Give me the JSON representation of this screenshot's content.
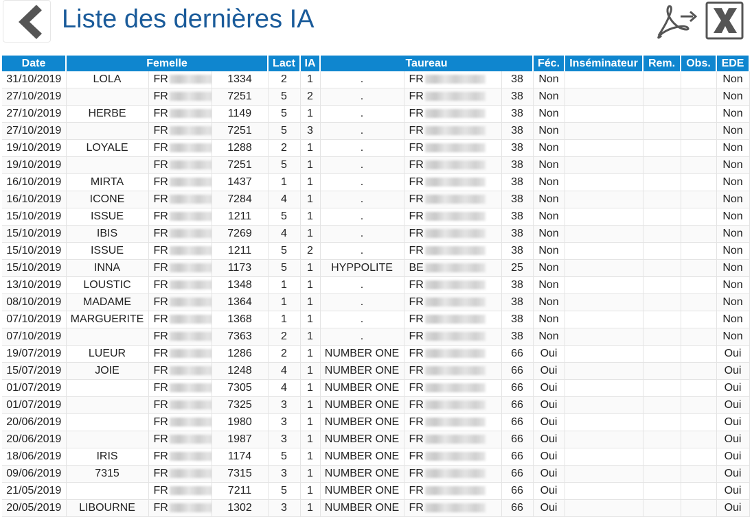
{
  "header": {
    "title": "Liste des dernières IA"
  },
  "icons": {
    "back": "chevron-left-icon",
    "pdf": "pdf-export-icon",
    "excel": "excel-export-icon"
  },
  "colors": {
    "header_bg": "#0f86cf",
    "title": "#1a5b9a"
  },
  "table": {
    "headers": {
      "date": "Date",
      "femelle": "Femelle",
      "lact": "Lact",
      "ia": "IA",
      "taureau": "Taureau",
      "fec": "Féc.",
      "inseminateur": "Inséminateur",
      "rem": "Rem.",
      "obs": "Obs.",
      "ede": "EDE"
    },
    "rows": [
      {
        "date": "31/10/2019",
        "name": "LOLA",
        "fr": "FR",
        "num": "1334",
        "lact": "2",
        "ia": "1",
        "bull": ".",
        "bull_fr": "FR",
        "bull_code": "38",
        "fec": "Non",
        "ins": "",
        "rem": "",
        "obs": "",
        "ede": "Non"
      },
      {
        "date": "27/10/2019",
        "name": "",
        "fr": "FR",
        "num": "7251",
        "lact": "5",
        "ia": "2",
        "bull": ".",
        "bull_fr": "FR",
        "bull_code": "38",
        "fec": "Non",
        "ins": "",
        "rem": "",
        "obs": "",
        "ede": "Non"
      },
      {
        "date": "27/10/2019",
        "name": "HERBE",
        "fr": "FR",
        "num": "1149",
        "lact": "5",
        "ia": "1",
        "bull": ".",
        "bull_fr": "FR",
        "bull_code": "38",
        "fec": "Non",
        "ins": "",
        "rem": "",
        "obs": "",
        "ede": "Non"
      },
      {
        "date": "27/10/2019",
        "name": "",
        "fr": "FR",
        "num": "7251",
        "lact": "5",
        "ia": "3",
        "bull": ".",
        "bull_fr": "FR",
        "bull_code": "38",
        "fec": "Non",
        "ins": "",
        "rem": "",
        "obs": "",
        "ede": "Non"
      },
      {
        "date": "19/10/2019",
        "name": "LOYALE",
        "fr": "FR",
        "num": "1288",
        "lact": "2",
        "ia": "1",
        "bull": ".",
        "bull_fr": "FR",
        "bull_code": "38",
        "fec": "Non",
        "ins": "",
        "rem": "",
        "obs": "",
        "ede": "Non"
      },
      {
        "date": "19/10/2019",
        "name": "",
        "fr": "FR",
        "num": "7251",
        "lact": "5",
        "ia": "1",
        "bull": ".",
        "bull_fr": "FR",
        "bull_code": "38",
        "fec": "Non",
        "ins": "",
        "rem": "",
        "obs": "",
        "ede": "Non"
      },
      {
        "date": "16/10/2019",
        "name": "MIRTA",
        "fr": "FR",
        "num": "1437",
        "lact": "1",
        "ia": "1",
        "bull": ".",
        "bull_fr": "FR",
        "bull_code": "38",
        "fec": "Non",
        "ins": "",
        "rem": "",
        "obs": "",
        "ede": "Non"
      },
      {
        "date": "16/10/2019",
        "name": "ICONE",
        "fr": "FR",
        "num": "7284",
        "lact": "4",
        "ia": "1",
        "bull": ".",
        "bull_fr": "FR",
        "bull_code": "38",
        "fec": "Non",
        "ins": "",
        "rem": "",
        "obs": "",
        "ede": "Non"
      },
      {
        "date": "15/10/2019",
        "name": "ISSUE",
        "fr": "FR",
        "num": "1211",
        "lact": "5",
        "ia": "1",
        "bull": ".",
        "bull_fr": "FR",
        "bull_code": "38",
        "fec": "Non",
        "ins": "",
        "rem": "",
        "obs": "",
        "ede": "Non"
      },
      {
        "date": "15/10/2019",
        "name": "IBIS",
        "fr": "FR",
        "num": "7269",
        "lact": "4",
        "ia": "1",
        "bull": ".",
        "bull_fr": "FR",
        "bull_code": "38",
        "fec": "Non",
        "ins": "",
        "rem": "",
        "obs": "",
        "ede": "Non"
      },
      {
        "date": "15/10/2019",
        "name": "ISSUE",
        "fr": "FR",
        "num": "1211",
        "lact": "5",
        "ia": "2",
        "bull": ".",
        "bull_fr": "FR",
        "bull_code": "38",
        "fec": "Non",
        "ins": "",
        "rem": "",
        "obs": "",
        "ede": "Non"
      },
      {
        "date": "15/10/2019",
        "name": "INNA",
        "fr": "FR",
        "num": "1173",
        "lact": "5",
        "ia": "1",
        "bull": "HYPPOLITE",
        "bull_fr": "BE",
        "bull_code": "25",
        "fec": "Non",
        "ins": "",
        "rem": "",
        "obs": "",
        "ede": "Non"
      },
      {
        "date": "13/10/2019",
        "name": "LOUSTIC",
        "fr": "FR",
        "num": "1348",
        "lact": "1",
        "ia": "1",
        "bull": ".",
        "bull_fr": "FR",
        "bull_code": "38",
        "fec": "Non",
        "ins": "",
        "rem": "",
        "obs": "",
        "ede": "Non"
      },
      {
        "date": "08/10/2019",
        "name": "MADAME",
        "fr": "FR",
        "num": "1364",
        "lact": "1",
        "ia": "1",
        "bull": ".",
        "bull_fr": "FR",
        "bull_code": "38",
        "fec": "Non",
        "ins": "",
        "rem": "",
        "obs": "",
        "ede": "Non"
      },
      {
        "date": "07/10/2019",
        "name": "MARGUERITE",
        "fr": "FR",
        "num": "1368",
        "lact": "1",
        "ia": "1",
        "bull": ".",
        "bull_fr": "FR",
        "bull_code": "38",
        "fec": "Non",
        "ins": "",
        "rem": "",
        "obs": "",
        "ede": "Non"
      },
      {
        "date": "07/10/2019",
        "name": "",
        "fr": "FR",
        "num": "7363",
        "lact": "2",
        "ia": "1",
        "bull": ".",
        "bull_fr": "FR",
        "bull_code": "38",
        "fec": "Non",
        "ins": "",
        "rem": "",
        "obs": "",
        "ede": "Non"
      },
      {
        "date": "19/07/2019",
        "name": "LUEUR",
        "fr": "FR",
        "num": "1286",
        "lact": "2",
        "ia": "1",
        "bull": "NUMBER ONE",
        "bull_fr": "FR",
        "bull_code": "66",
        "fec": "Oui",
        "ins": "",
        "rem": "",
        "obs": "",
        "ede": "Oui"
      },
      {
        "date": "15/07/2019",
        "name": "JOIE",
        "fr": "FR",
        "num": "1248",
        "lact": "4",
        "ia": "1",
        "bull": "NUMBER ONE",
        "bull_fr": "FR",
        "bull_code": "66",
        "fec": "Oui",
        "ins": "",
        "rem": "",
        "obs": "",
        "ede": "Oui"
      },
      {
        "date": "01/07/2019",
        "name": "",
        "fr": "FR",
        "num": "7305",
        "lact": "4",
        "ia": "1",
        "bull": "NUMBER ONE",
        "bull_fr": "FR",
        "bull_code": "66",
        "fec": "Oui",
        "ins": "",
        "rem": "",
        "obs": "",
        "ede": "Oui"
      },
      {
        "date": "01/07/2019",
        "name": "",
        "fr": "FR",
        "num": "7325",
        "lact": "3",
        "ia": "1",
        "bull": "NUMBER ONE",
        "bull_fr": "FR",
        "bull_code": "66",
        "fec": "Oui",
        "ins": "",
        "rem": "",
        "obs": "",
        "ede": "Oui"
      },
      {
        "date": "20/06/2019",
        "name": "",
        "fr": "FR",
        "num": "1980",
        "lact": "3",
        "ia": "1",
        "bull": "NUMBER ONE",
        "bull_fr": "FR",
        "bull_code": "66",
        "fec": "Oui",
        "ins": "",
        "rem": "",
        "obs": "",
        "ede": "Oui"
      },
      {
        "date": "20/06/2019",
        "name": "",
        "fr": "FR",
        "num": "1987",
        "lact": "3",
        "ia": "1",
        "bull": "NUMBER ONE",
        "bull_fr": "FR",
        "bull_code": "66",
        "fec": "Oui",
        "ins": "",
        "rem": "",
        "obs": "",
        "ede": "Oui"
      },
      {
        "date": "18/06/2019",
        "name": "IRIS",
        "fr": "FR",
        "num": "1174",
        "lact": "5",
        "ia": "1",
        "bull": "NUMBER ONE",
        "bull_fr": "FR",
        "bull_code": "66",
        "fec": "Oui",
        "ins": "",
        "rem": "",
        "obs": "",
        "ede": "Oui"
      },
      {
        "date": "09/06/2019",
        "name": "7315",
        "fr": "FR",
        "num": "7315",
        "lact": "3",
        "ia": "1",
        "bull": "NUMBER ONE",
        "bull_fr": "FR",
        "bull_code": "66",
        "fec": "Oui",
        "ins": "",
        "rem": "",
        "obs": "",
        "ede": "Oui"
      },
      {
        "date": "21/05/2019",
        "name": "",
        "fr": "FR",
        "num": "7211",
        "lact": "5",
        "ia": "1",
        "bull": "NUMBER ONE",
        "bull_fr": "FR",
        "bull_code": "66",
        "fec": "Oui",
        "ins": "",
        "rem": "",
        "obs": "",
        "ede": "Oui"
      },
      {
        "date": "20/05/2019",
        "name": "LIBOURNE",
        "fr": "FR",
        "num": "1302",
        "lact": "3",
        "ia": "1",
        "bull": "NUMBER ONE",
        "bull_fr": "FR",
        "bull_code": "66",
        "fec": "Oui",
        "ins": "",
        "rem": "",
        "obs": "",
        "ede": "Oui"
      }
    ]
  }
}
